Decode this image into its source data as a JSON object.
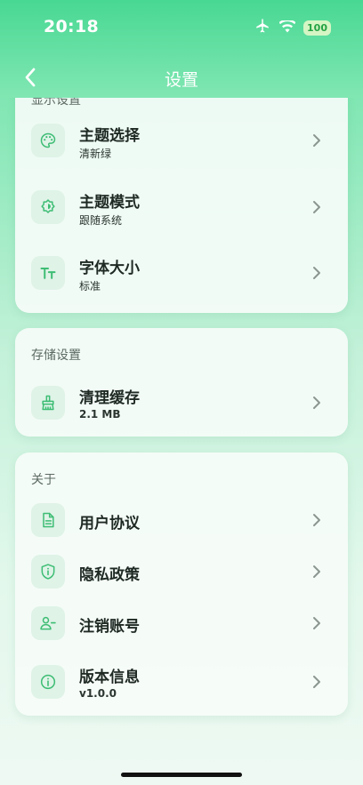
{
  "status": {
    "time": "20:18",
    "battery": "100"
  },
  "header": {
    "title": "设置"
  },
  "display_section": {
    "label": "显示设置",
    "items": [
      {
        "title": "主题选择",
        "subtitle": "清新绿",
        "icon": "palette-icon"
      },
      {
        "title": "主题模式",
        "subtitle": "跟随系统",
        "icon": "theme-mode-icon"
      },
      {
        "title": "字体大小",
        "subtitle": "标准",
        "icon": "font-size-icon"
      }
    ]
  },
  "storage_section": {
    "label": "存储设置",
    "items": [
      {
        "title": "清理缓存",
        "subtitle": "2.1 MB",
        "icon": "broom-icon"
      }
    ]
  },
  "about_section": {
    "label": "关于",
    "items": [
      {
        "title": "用户协议",
        "icon": "document-icon"
      },
      {
        "title": "隐私政策",
        "icon": "shield-icon"
      },
      {
        "title": "注销账号",
        "icon": "user-remove-icon"
      },
      {
        "title": "版本信息",
        "subtitle": "v1.0.0",
        "icon": "info-icon"
      }
    ]
  },
  "colors": {
    "accent": "#3dbd74",
    "header_bg": "#48d893"
  }
}
